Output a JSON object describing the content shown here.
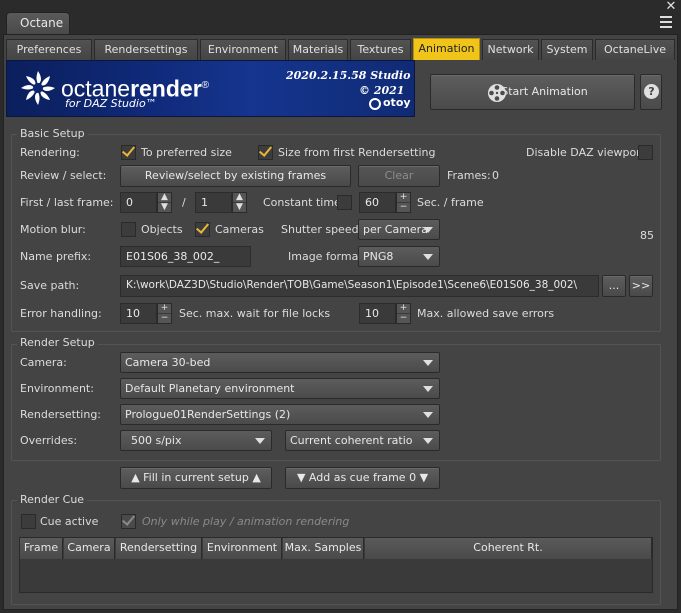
{
  "window": {
    "title": "Octane"
  },
  "tabs": [
    {
      "label": "Preferences"
    },
    {
      "label": "Rendersettings"
    },
    {
      "label": "Environment"
    },
    {
      "label": "Materials"
    },
    {
      "label": "Textures"
    },
    {
      "label": "Animation"
    },
    {
      "label": "Network"
    },
    {
      "label": "System"
    },
    {
      "label": "OctaneLive"
    }
  ],
  "active_tab": "Animation",
  "banner": {
    "brand_light": "octane",
    "brand_bold": "render",
    "registered": "®",
    "subtitle": "for DAZ Studio™",
    "version": "2020.2.15.58 Studio",
    "copyright": "© 2021",
    "company": "otoy"
  },
  "start_animation_label": "Start Animation",
  "help_glyph": "?",
  "basic_setup": {
    "title": "Basic Setup",
    "rendering_label": "Rendering:",
    "to_preferred_size": {
      "label": "To preferred size",
      "checked": true
    },
    "size_from_first": {
      "label": "Size from first Rendersetting",
      "checked": true
    },
    "disable_viewport": {
      "label": "Disable DAZ viewport",
      "checked": false
    },
    "review_label": "Review / select:",
    "review_button": "Review/select by existing frames",
    "clear_button": "Clear",
    "frames_label": "Frames:",
    "frames_value": "0",
    "first_last_label": "First / last frame:",
    "first_frame": "0",
    "slash": "/",
    "last_frame": "1",
    "constant_time_label": "Constant time:",
    "constant_time_value": "60",
    "sec_frame_label": "Sec. / frame",
    "motion_blur_label": "Motion blur:",
    "objects": {
      "label": "Objects",
      "checked": false
    },
    "cameras": {
      "label": "Cameras",
      "checked": true
    },
    "shutter_label": "Shutter speed:",
    "shutter_value": "per Camera",
    "shutter_number": "85",
    "name_prefix_label": "Name prefix:",
    "name_prefix_value": "E01S06_38_002_",
    "image_format_label": "Image format:",
    "image_format_value": "PNG8",
    "save_path_label": "Save path:",
    "save_path_value": "K:\\work\\DAZ3D\\Studio\\Render\\TOB\\Game\\Season1\\Episode1\\Scene6\\E01S06_38_002\\",
    "browse_button": "...",
    "open_button": ">>",
    "error_label": "Error handling:",
    "wait_value": "10",
    "wait_label": "Sec. max. wait for file locks",
    "max_errors_value": "10",
    "max_errors_label": "Max. allowed save errors"
  },
  "render_setup": {
    "title": "Render Setup",
    "camera_label": "Camera:",
    "camera_value": "Camera 30-bed",
    "environment_label": "Environment:",
    "environment_value": "Default Planetary environment",
    "rendersetting_label": "Rendersetting:",
    "rendersetting_value": "Prologue01RenderSettings (2)",
    "overrides_label": "Overrides:",
    "override_samples": "500 s/pix",
    "override_ratio": "Current coherent ratio"
  },
  "fill_button": "▲ Fill in current setup ▲",
  "add_cue_button": "▼ Add as cue frame 0 ▼",
  "render_cue": {
    "title": "Render Cue",
    "cue_active": {
      "label": "Cue active",
      "checked": false
    },
    "only_while_play": {
      "label": "Only while play / animation rendering",
      "checked": true
    },
    "columns": [
      "Frame",
      "Camera",
      "Rendersetting",
      "Environment",
      "Max. Samples",
      "Coherent Rt."
    ]
  }
}
